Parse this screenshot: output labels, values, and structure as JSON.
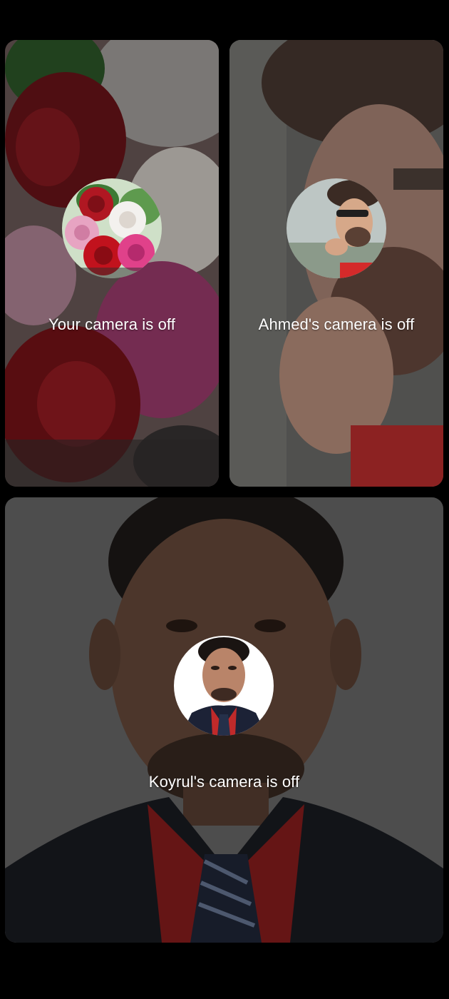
{
  "participants": [
    {
      "id": "you",
      "label": "Your camera is off",
      "avatar_icon": "roses-avatar-icon",
      "bg_color": "#7a3a3f"
    },
    {
      "id": "ahmed",
      "label": "Ahmed's camera is off",
      "avatar_icon": "man-portrait-avatar-icon",
      "bg_color": "#5c5655"
    },
    {
      "id": "koyrul",
      "label": "Koyrul's camera is off",
      "avatar_icon": "man-portrait-avatar-icon",
      "bg_color": "#4a4a4a"
    }
  ],
  "theme": {
    "screen_bg": "#000000",
    "caption_color": "#ffffff"
  }
}
